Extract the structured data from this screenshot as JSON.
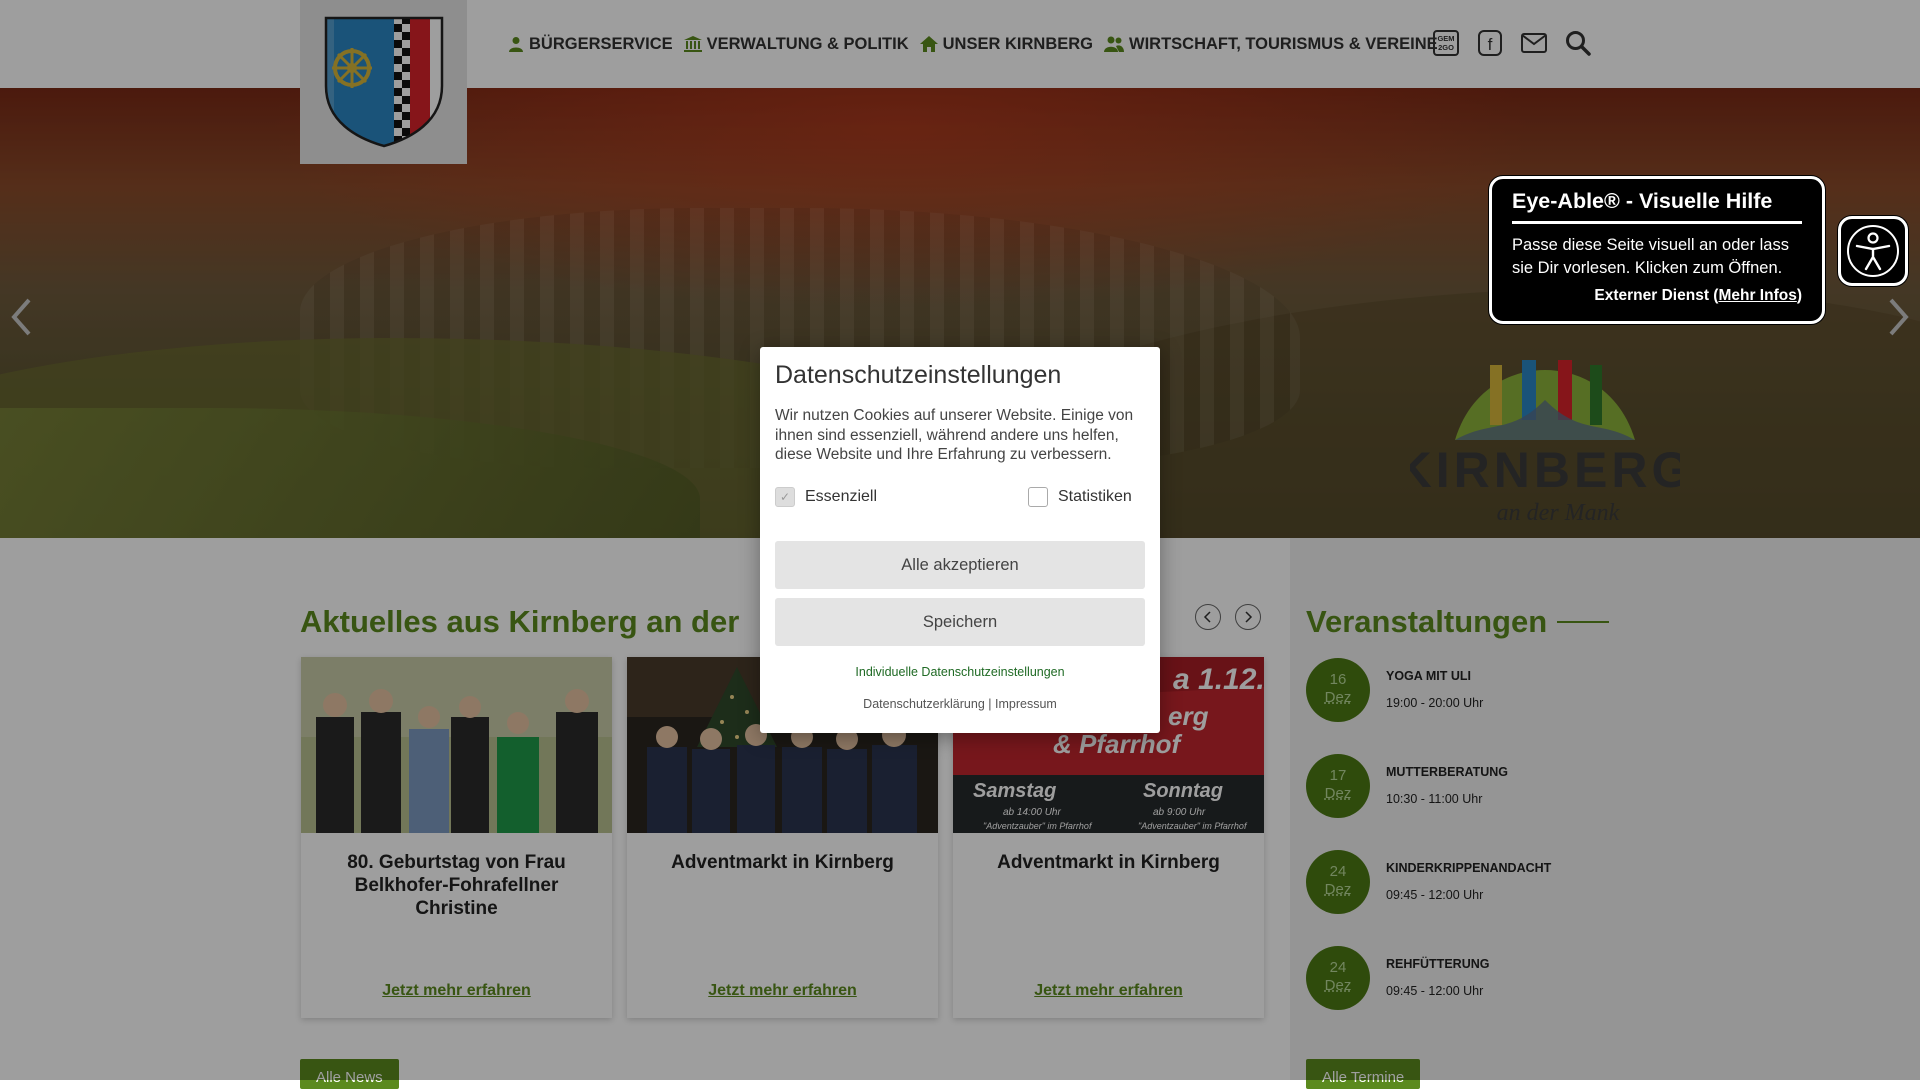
{
  "header": {
    "nav": [
      {
        "label": "BÜRGERSERVICE",
        "icon": "user-icon"
      },
      {
        "label": "VERWALTUNG & POLITIK",
        "icon": "bank-icon"
      },
      {
        "label": "UNSER KIRNBERG",
        "icon": "home-icon"
      },
      {
        "label": "WIRTSCHAFT, TOURISMUS & VEREINE",
        "icon": "group-icon"
      }
    ],
    "icons": [
      "gem2go-icon",
      "facebook-icon",
      "mail-icon",
      "search-icon"
    ],
    "gem_label_top": "GEM",
    "gem_label_bottom": "2GO",
    "facebook_glyph": "f"
  },
  "hero": {
    "logo_text": "KIRNBERG",
    "logo_subtext": "an der Mank"
  },
  "news": {
    "title": "Aktuelles aus Kirnberg an der",
    "cards": [
      {
        "title": "80. Geburtstag von Frau Belkhofer-Fohrafellner Christine",
        "link": "Jetzt mehr erfahren"
      },
      {
        "title": "Adventmarkt in Kirnberg",
        "link": "Jetzt mehr erfahren"
      },
      {
        "title": "Adventmarkt in Kirnberg",
        "link": "Jetzt mehr erfahren",
        "poster": {
          "top_text": "a 1.12.",
          "middle_text": "erg",
          "bottom_text": "& Pfarrhof",
          "day1": "Samstag",
          "day1_sub": "ab 14:00 Uhr",
          "day1_sub2": "\"Adventzauber\" im Pfarrhof",
          "day2": "Sonntag",
          "day2_sub": "ab 9:00 Uhr",
          "day2_sub2": "\"Adventzauber\" im Pfarrhof"
        }
      }
    ],
    "all_button": "Alle News"
  },
  "events": {
    "title": "Veranstaltungen",
    "items": [
      {
        "day": "16",
        "month": "Dez",
        "name": "YOGA MIT ULI",
        "time": "19:00 - 20:00 Uhr"
      },
      {
        "day": "17",
        "month": "Dez",
        "name": "MUTTERBERATUNG",
        "time": "10:30 - 11:00 Uhr"
      },
      {
        "day": "24",
        "month": "Dez",
        "name": "KINDERKRIPPENANDACHT",
        "time": "09:45 - 12:00 Uhr"
      },
      {
        "day": "24",
        "month": "Dez",
        "name": "REHFÜTTERUNG",
        "time": "09:45 - 12:00 Uhr"
      }
    ],
    "all_button": "Alle Termine"
  },
  "cookie_modal": {
    "title": "Datenschutzeinstellungen",
    "text": "Wir nutzen Cookies auf unserer Website. Einige von ihnen sind essenziell, während andere uns helfen, diese Website und Ihre Erfahrung zu verbessern.",
    "option_essential": "Essenziell",
    "option_statistics": "Statistiken",
    "accept_all": "Alle akzeptieren",
    "save": "Speichern",
    "individual": "Individuelle Datenschutzeinstellungen",
    "privacy": "Datenschutzerklärung",
    "separator": "|",
    "imprint": "Impressum"
  },
  "eye_able": {
    "title": "Eye-Able® - Visuelle Hilfe",
    "text": "Passe diese Seite visuell an oder lass sie Dir vorlesen. Klicken zum Öffnen.",
    "ext_prefix": "Externer Dienst (",
    "ext_link": "Mehr Infos",
    "ext_suffix": ")"
  },
  "colors": {
    "accent_green": "#5b8a1e",
    "date_circle": "#4c7a14"
  }
}
